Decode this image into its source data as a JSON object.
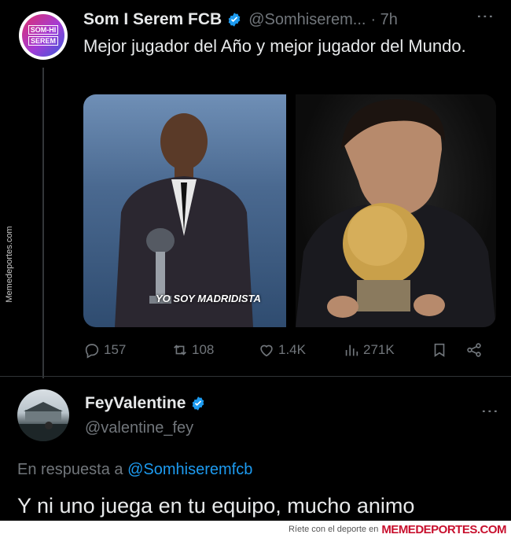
{
  "watermark": "Memedeportes.com",
  "tweet": {
    "avatar_text": [
      "SOM-HI",
      "SEREM"
    ],
    "author_name": "Som I Serem FCB",
    "handle": "@Somhiserem...",
    "time": "· 7h",
    "more": "⋮",
    "text": "Mejor jugador del Año y mejor jugador del Mundo.",
    "image_overlay": "YO SOY MADRIDISTA",
    "stats": {
      "replies": "157",
      "retweets": "108",
      "likes": "1.4K",
      "views": "271K"
    }
  },
  "reply": {
    "author_name": "FeyValentine",
    "handle": "@valentine_fey",
    "more": "⋮",
    "reply_prefix": "En respuesta a",
    "reply_mention": "@Somhiseremfcb",
    "text": "Y ni uno juega en tu equipo, mucho animo"
  },
  "footer": {
    "tagline": "Ríete con el deporte en",
    "brand": "MEMEDEPORTES.COM"
  },
  "colors": {
    "background": "#000000",
    "text": "#e7e9ea",
    "muted": "#71767b",
    "accent": "#1d9bf0"
  }
}
